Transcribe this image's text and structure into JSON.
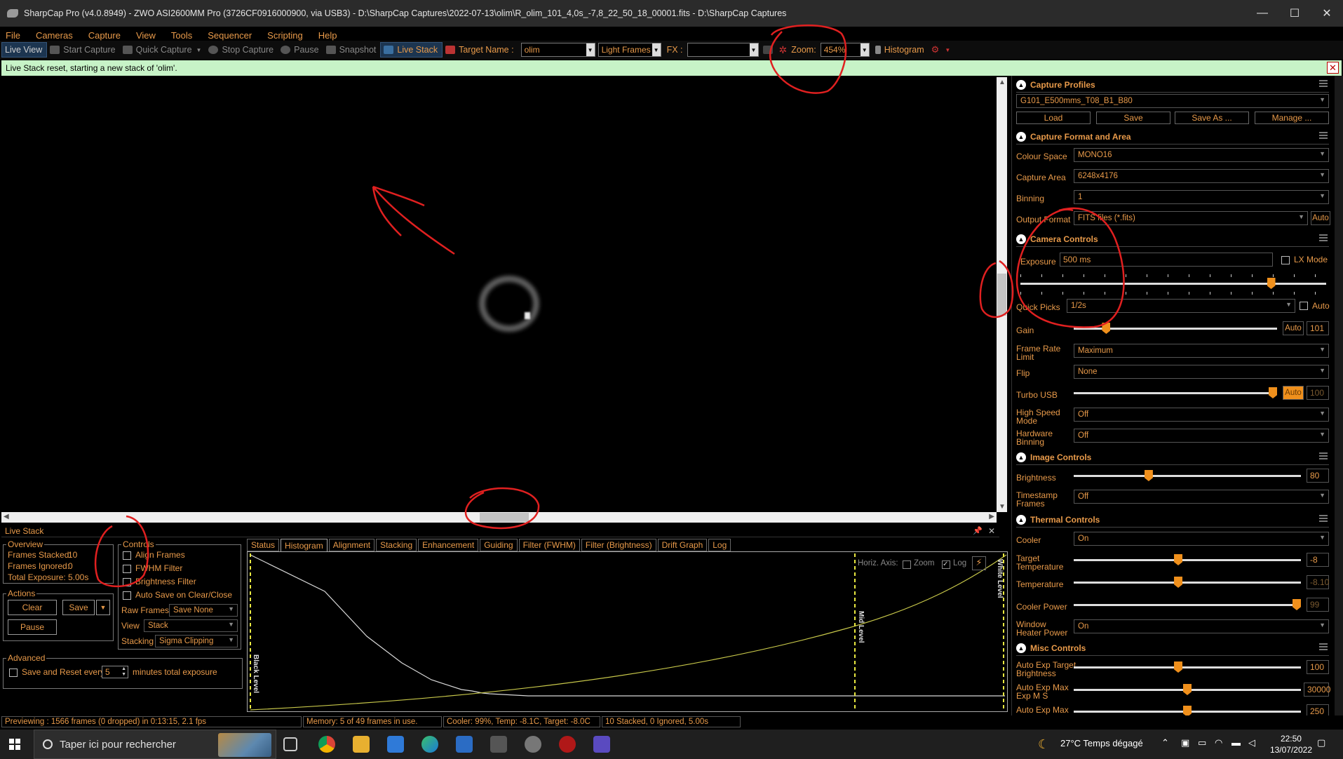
{
  "window": {
    "title": "SharpCap Pro (v4.0.8949) - ZWO ASI2600MM Pro (3726CF0916000900, via USB3) - D:\\SharpCap Captures\\2022-07-13\\olim\\R_olim_101_4,0s_-7,8_22_50_18_00001.fits - D:\\SharpCap Captures",
    "minimize": "—",
    "maximize": "☐",
    "close": "✕"
  },
  "menu": [
    "File",
    "Cameras",
    "Capture",
    "View",
    "Tools",
    "Sequencer",
    "Scripting",
    "Help"
  ],
  "toolbar": {
    "live_view": "Live View",
    "start_capture": "Start Capture",
    "quick_capture": "Quick Capture",
    "stop_capture": "Stop Capture",
    "pause": "Pause",
    "snapshot": "Snapshot",
    "live_stack": "Live Stack",
    "target_name_label": "Target Name :",
    "target_name": "olim",
    "frame_type": "Light Frames",
    "fx_label": "FX :",
    "fx_value": "",
    "zoom_label": "Zoom:",
    "zoom_value": "454%",
    "histogram": "Histogram"
  },
  "notification": "Live Stack reset, starting a new stack of 'olim'.",
  "right_panel": {
    "capture_profiles": {
      "title": "Capture Profiles",
      "profile": "G101_E500mms_T08_B1_B80",
      "load": "Load",
      "save": "Save",
      "save_as": "Save As ...",
      "manage": "Manage ..."
    },
    "capture_format": {
      "title": "Capture Format and Area",
      "colour_space_label": "Colour Space",
      "colour_space": "MONO16",
      "capture_area_label": "Capture Area",
      "capture_area": "6248x4176",
      "binning_label": "Binning",
      "binning": "1",
      "output_format_label": "Output Format",
      "output_format": "FITS files (*.fits)",
      "auto": "Auto"
    },
    "camera_controls": {
      "title": "Camera Controls",
      "exposure_label": "Exposure",
      "exposure": "500 ms",
      "lx_mode": "LX Mode",
      "quick_picks_label": "Quick Picks",
      "quick_picks": "1/2s",
      "auto": "Auto",
      "gain_label": "Gain",
      "gain_auto": "Auto",
      "gain": "101",
      "frame_rate_label": "Frame Rate Limit",
      "frame_rate": "Maximum",
      "flip_label": "Flip",
      "flip": "None",
      "turbo_usb_label": "Turbo USB",
      "turbo_auto": "Auto",
      "turbo_usb": "100",
      "high_speed_label": "High Speed Mode",
      "high_speed": "Off",
      "hw_binning_label": "Hardware Binning",
      "hw_binning": "Off"
    },
    "image_controls": {
      "title": "Image Controls",
      "brightness_label": "Brightness",
      "brightness": "80",
      "timestamp_label": "Timestamp Frames",
      "timestamp": "Off"
    },
    "thermal_controls": {
      "title": "Thermal Controls",
      "cooler_label": "Cooler",
      "cooler": "On",
      "target_temp_label": "Target Temperature",
      "target_temp": "-8",
      "temperature_label": "Temperature",
      "temperature": "-8.10",
      "cooler_power_label": "Cooler Power",
      "cooler_power": "99",
      "window_heater_label": "Window Heater Power",
      "window_heater": "On"
    },
    "misc_controls": {
      "title": "Misc Controls",
      "auto_exp_target_label": "Auto Exp Target Brightness",
      "auto_exp_target": "100",
      "auto_exp_max_label": "Auto Exp Max Exp M S",
      "auto_exp_max": "30000",
      "auto_exp_max2_label": "Auto Exp Max",
      "auto_exp_max2": "250"
    },
    "levels": {
      "exposure_fraction": 0.82,
      "gain_fraction": 0.16,
      "turbo_fraction": 0.99,
      "brightness_fraction": 0.33,
      "target_temp_fraction": 0.46,
      "temperature_fraction": 0.46,
      "cooler_power_fraction": 0.99,
      "auto_exp_target_fraction": 0.46,
      "auto_exp_max_fraction": 0.5,
      "auto_exp_max2_fraction": 0.5
    }
  },
  "live_stack": {
    "title": "Live Stack",
    "overview_label": "Overview",
    "frames_stacked_label": "Frames Stacked:",
    "frames_stacked": "10",
    "frames_ignored_label": "Frames Ignored:",
    "frames_ignored": "0",
    "total_exposure_label": "Total Exposure:",
    "total_exposure": "5.00s",
    "actions_label": "Actions",
    "clear": "Clear",
    "save": "Save",
    "pause": "Pause",
    "advanced_label": "Advanced",
    "save_reset_label": "Save and Reset every",
    "save_reset_value": "5",
    "minutes_label": "minutes total exposure",
    "controls_label": "Controls",
    "align_frames": "Align Frames",
    "fwhm_filter": "FWHM Filter",
    "brightness_filter": "Brightness Filter",
    "auto_save": "Auto Save on Clear/Close",
    "raw_frames_label": "Raw Frames",
    "raw_frames": "Save None",
    "view_label": "View",
    "view": "Stack",
    "stacking_label": "Stacking",
    "stacking": "Sigma Clipping",
    "tabs": [
      "Status",
      "Histogram",
      "Alignment",
      "Stacking",
      "Enhancement",
      "Guiding",
      "Filter (FWHM)",
      "Filter (Brightness)",
      "Drift Graph",
      "Log"
    ],
    "histogram": {
      "horiz_axis_label": "Horiz. Axis:",
      "zoom": "Zoom",
      "log": "Log",
      "black_level": "Black Level",
      "mid_level": "Mid Level",
      "white_level": "White Level"
    }
  },
  "status_bar": {
    "previewing": "Previewing : 1566 frames (0 dropped) in 0:13:15, 2.1 fps",
    "memory": "Memory: 5 of 49 frames in use.",
    "cooler": "Cooler: 99%, Temp: -8.1C, Target: -8.0C",
    "stacked": "10 Stacked, 0 Ignored, 5.00s"
  },
  "taskbar": {
    "search_placeholder": "Taper ici pour rechercher",
    "weather": "27°C  Temps dégagé",
    "time": "22:50",
    "date": "13/07/2022"
  }
}
